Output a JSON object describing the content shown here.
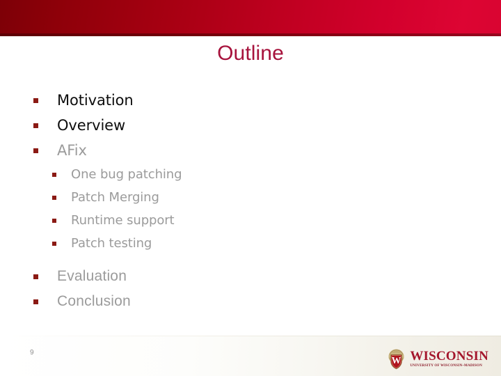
{
  "slide": {
    "title": "Outline",
    "page_number": "9",
    "accent_header_left": "#7d0007",
    "accent_header_right": "#dd0533",
    "title_color": "#a7123c",
    "bullet_marker_color": "#8b1a14",
    "text_color_active": "#0d0d0d",
    "text_color_muted": "#9b9b9b"
  },
  "outline": {
    "items": [
      {
        "label": "Motivation",
        "level": 1,
        "tone": "dark",
        "face": "narrow"
      },
      {
        "label": "Overview",
        "level": 1,
        "tone": "dark",
        "face": "narrow"
      },
      {
        "label": "AFix",
        "level": 1,
        "tone": "muted",
        "face": "narrow"
      },
      {
        "label": "One bug patching",
        "level": 2,
        "tone": "muted",
        "face": "narrow"
      },
      {
        "label": "Patch Merging",
        "level": 2,
        "tone": "muted",
        "face": "narrow"
      },
      {
        "label": "Runtime support",
        "level": 2,
        "tone": "muted",
        "face": "narrow"
      },
      {
        "label": "Patch testing",
        "level": 2,
        "tone": "muted",
        "face": "narrow"
      },
      {
        "label": "Evaluation",
        "level": 1,
        "tone": "muted",
        "face": "wide"
      },
      {
        "label": "Conclusion",
        "level": 1,
        "tone": "muted",
        "face": "wide"
      }
    ]
  },
  "logo": {
    "wordmark": "WISCONSIN",
    "subtitle": "UNIVERSITY OF WISCONSIN–MADISON",
    "crest_letter": "W",
    "crest_shield_color": "#b0141e",
    "crest_ring_color": "#b39a5e",
    "wordmark_color": "#a4162c"
  }
}
